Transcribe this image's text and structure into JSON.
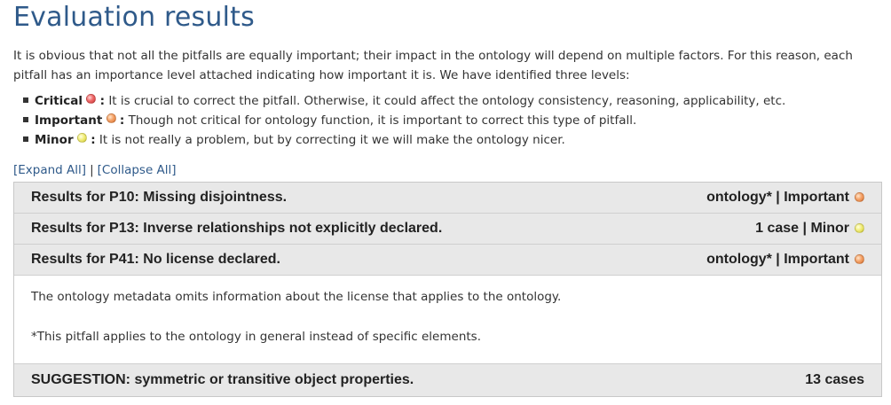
{
  "title": "Evaluation results",
  "intro": "It is obvious that not all the pitfalls are equally important; their impact in the ontology will depend on multiple factors. For this reason, each pitfall has an importance level attached indicating how important it is. We have identified three levels:",
  "levels": [
    {
      "name": "Critical",
      "colon": ":",
      "description": "It is crucial to correct the pitfall. Otherwise, it could affect the ontology consistency, reasoning, applicability, etc.",
      "color": "#e05050"
    },
    {
      "name": "Important",
      "colon": ":",
      "description": "Though not critical for ontology function, it is important to correct this type of pitfall.",
      "color": "#ee8f50"
    },
    {
      "name": "Minor",
      "colon": ":",
      "description": "It is not really a problem, but by correcting it we will make the ontology nicer.",
      "color": "#e6e060"
    }
  ],
  "controls": {
    "expand_all": "[Expand All]",
    "separator": "|",
    "collapse_all": "[Collapse All]"
  },
  "results": [
    {
      "title": "Results for P10: Missing disjointness.",
      "summary": "ontology* | Important",
      "level_color": "#ee8f50",
      "expanded": false
    },
    {
      "title": "Results for P13: Inverse relationships not explicitly declared.",
      "summary": "1 case | Minor",
      "level_color": "#e6e060",
      "expanded": false
    },
    {
      "title": "Results for P41: No license declared.",
      "summary": "ontology* | Important",
      "level_color": "#ee8f50",
      "expanded": true,
      "body": [
        "The ontology metadata omits information about the license that applies to the ontology.",
        "*This pitfall applies to the ontology in general instead of specific elements."
      ]
    }
  ],
  "suggestion": {
    "title": "SUGGESTION: symmetric or transitive object properties.",
    "summary": "13 cases"
  }
}
